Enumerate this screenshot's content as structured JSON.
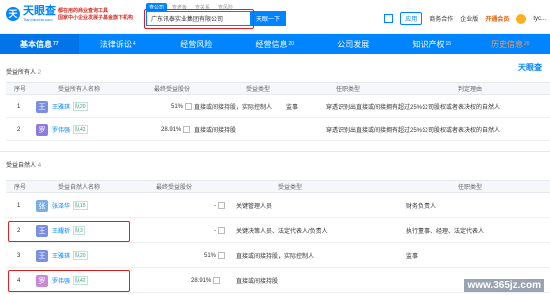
{
  "header": {
    "logo": {
      "mark": "天",
      "cn": "天眼查",
      "en": "TianYancha.com"
    },
    "promo": [
      "都在用的商业查询工具",
      "国家中小企业发展子基金旗下机构"
    ],
    "search_tabs": [
      "查公司",
      "查老板",
      "查关系",
      "查风险"
    ],
    "search_value": "广东讯泰实业集团有限公司",
    "search_button": "天眼一下",
    "app_label": "应用",
    "business": "商务合作",
    "enterprise": "企业版",
    "vip": "开通会员",
    "user": "tyc..."
  },
  "nav": [
    {
      "label": "基本信息",
      "count": "77"
    },
    {
      "label": "法律诉讼",
      "count": "4"
    },
    {
      "label": "经营风险",
      "count": ""
    },
    {
      "label": "经营信息",
      "count": "20"
    },
    {
      "label": "公司发展",
      "count": ""
    },
    {
      "label": "知识产权",
      "count": "15"
    },
    {
      "label": "历史信息",
      "count": "20"
    }
  ],
  "section1": {
    "title": "受益所有人",
    "count": "2",
    "watermark": "天眼查",
    "headers": [
      "序号",
      "受益所有人名称",
      "最终受益股份",
      "受益类型",
      "任职类型",
      "判定理由"
    ],
    "rows": [
      {
        "idx": "1",
        "avatar": "王",
        "avatar_color": "#7b8fe0",
        "name": "王雅琪",
        "tag": "队20",
        "share": "51%",
        "type": "直接或间接持股，实际控制人",
        "role": "监事",
        "reason": "穿透识别出直接或间接拥有超过25%公司股权或者表决权的自然人"
      },
      {
        "idx": "2",
        "avatar": "罗",
        "avatar_color": "#8e7be0",
        "name": "罗伟强",
        "tag": "队42",
        "share": "28.91%",
        "type": "直接或间接持股",
        "role": "",
        "reason": "穿透识别出直接或间接拥有超过25%公司股权或者表决权的自然人"
      }
    ]
  },
  "section2": {
    "title": "受益自然人",
    "count": "4",
    "headers": [
      "序号",
      "受益自然人名称",
      "最终受益股份",
      "受益类型",
      "任职类型"
    ],
    "rows": [
      {
        "idx": "1",
        "avatar": "张",
        "avatar_color": "#7baee0",
        "name": "张泽华",
        "tag": "队15",
        "share": "-",
        "type": "关键管理人员",
        "role": "财务负责人"
      },
      {
        "idx": "2",
        "avatar": "王",
        "avatar_color": "#7b8fe0",
        "name": "王耀祈",
        "tag": "队3",
        "share": "-",
        "type": "关键决策人员、法定代表人/负责人",
        "role": "执行董事、经理、法定代表人"
      },
      {
        "idx": "3",
        "avatar": "王",
        "avatar_color": "#7b8fe0",
        "name": "王雅琪",
        "tag": "队20",
        "share": "51%",
        "type": "直接或间接持股，实际控制人",
        "role": "监事"
      },
      {
        "idx": "4",
        "avatar": "罗",
        "avatar_color": "#c88ad8",
        "name": "罗伟强",
        "tag": "队42",
        "share": "28.91%",
        "type": "直接或间接持股",
        "role": ""
      }
    ]
  },
  "footer_watermark": "www.365jz.com",
  "colors": {
    "brand": "#0084ff",
    "highlight": "#e02020"
  }
}
